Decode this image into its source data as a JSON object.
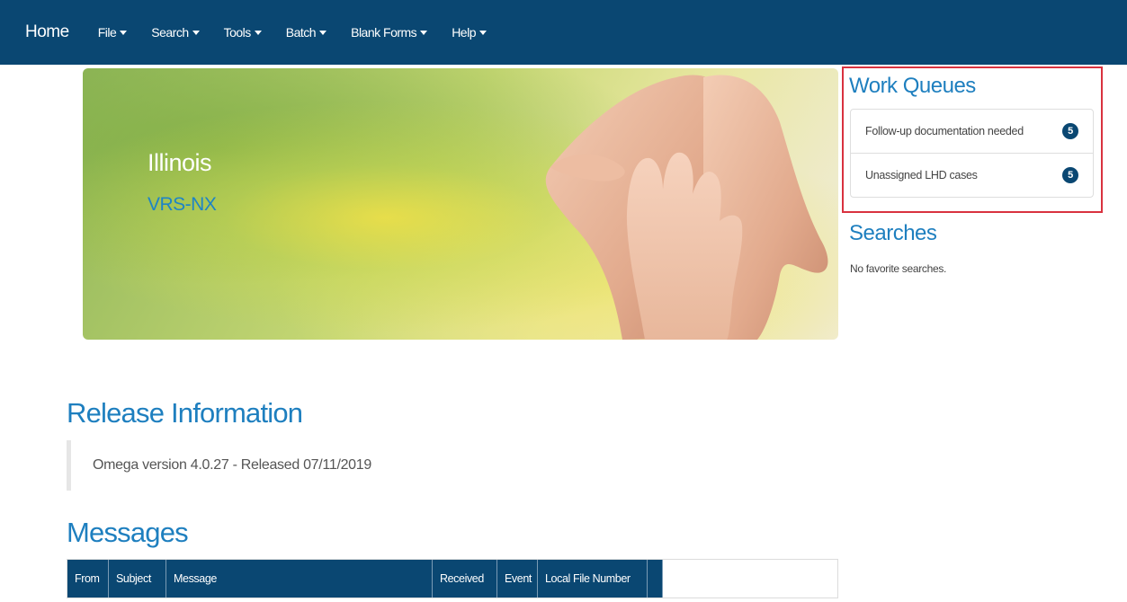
{
  "nav": {
    "brand": "Home",
    "menus": [
      {
        "label": "File"
      },
      {
        "label": "Search"
      },
      {
        "label": "Tools"
      },
      {
        "label": "Batch"
      },
      {
        "label": "Blank Forms"
      },
      {
        "label": "Help"
      }
    ]
  },
  "hero": {
    "title": "Illinois",
    "subtitle": "VRS-NX"
  },
  "work_queues": {
    "title": "Work Queues",
    "items": [
      {
        "label": "Follow-up documentation needed",
        "count": "5"
      },
      {
        "label": "Unassigned LHD cases",
        "count": "5"
      }
    ]
  },
  "searches": {
    "title": "Searches",
    "empty_text": "No favorite searches."
  },
  "release": {
    "title": "Release Information",
    "text": "Omega version 4.0.27 - Released 07/11/2019"
  },
  "messages": {
    "title": "Messages",
    "columns": [
      "From",
      "Subject",
      "Message",
      "Received",
      "Event",
      "Local File Number"
    ]
  },
  "colors": {
    "navbar": "#0a4772",
    "accent": "#1e7fbf",
    "highlight_outline": "#d9323f"
  }
}
